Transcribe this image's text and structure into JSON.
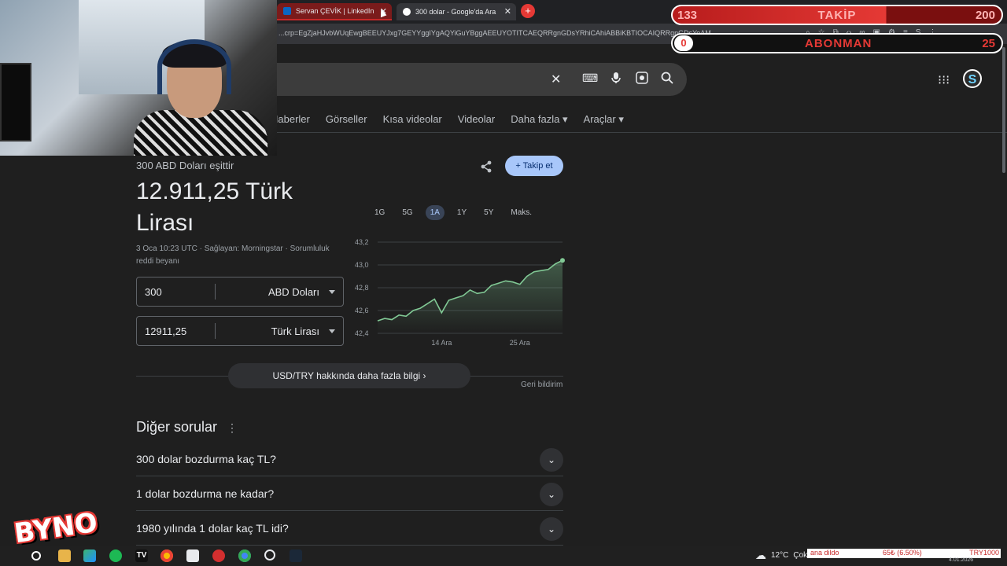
{
  "browser": {
    "tabs": [
      {
        "label": "Servan ÇEVİK | LinkedIn"
      },
      {
        "label": "300 dolar - Google'da Ara"
      }
    ],
    "new_tab": "+",
    "url": "...crp=EgZjaHJvbWUqEwgBEEUYJxg7GEYYggIYgAQYiGuYBggAEEUYOTITCAEQRRgnGDsYRhiCAhiABBiKBTIOCAIQRRgnGDsYoAM..."
  },
  "search": {
    "clear_icon": "✕",
    "keyboard_icon": "⌨",
    "mic_icon": "🎤",
    "lens_icon": "◉",
    "search_icon": "⌕"
  },
  "nav": {
    "tabs": [
      "Haberler",
      "Görseller",
      "Kısa videolar",
      "Videolar",
      "Daha fazla ▾",
      "Araçlar ▾"
    ]
  },
  "converter": {
    "equal_text": "300 ABD Doları eşittir",
    "result": "12.911,25 Türk Lirası",
    "source": "3 Oca 10:23 UTC · Sağlayan: Morningstar · Sorumluluk reddi beyanı",
    "follow_label": "+ Takip et",
    "from": {
      "value": "300",
      "currency": "ABD Doları"
    },
    "to": {
      "value": "12911,25",
      "currency": "Türk Lirası"
    },
    "ranges": [
      "1G",
      "5G",
      "1A",
      "1Y",
      "5Y",
      "Maks."
    ],
    "active_range": "1A",
    "more_button": "USD/TRY hakkında daha fazla bilgi  ›",
    "feedback": "Geri bildirim"
  },
  "chart_data": {
    "type": "area",
    "x_tick_labels": [
      "14 Ara",
      "25 Ara"
    ],
    "y_ticks": [
      42.4,
      42.6,
      42.8,
      43.0,
      43.2
    ],
    "y_tick_labels": [
      "42,4",
      "42,6",
      "42,8",
      "43,0",
      "43,2"
    ],
    "ylim": [
      42.4,
      43.2
    ],
    "values": [
      42.51,
      42.53,
      42.52,
      42.56,
      42.55,
      42.6,
      42.62,
      42.66,
      42.7,
      42.58,
      42.69,
      42.71,
      42.73,
      42.78,
      42.75,
      42.76,
      42.82,
      42.84,
      42.86,
      42.85,
      42.83,
      42.9,
      42.94,
      42.95,
      42.96,
      43.01,
      43.04
    ],
    "x_tick_index": [
      9,
      20
    ],
    "color": "#81c995",
    "grid": true
  },
  "other": {
    "title": "Diğer sorular",
    "menu": "⋮",
    "questions": [
      "300 dolar bozdurma kaç TL?",
      "1 dolar bozdurma ne kadar?",
      "1980 yılında 1 dolar kaç TL idi?"
    ]
  },
  "overlay": {
    "takip": {
      "count": "133",
      "label": "TAKİP",
      "goal": "200"
    },
    "abone": {
      "count": "0",
      "label": "ABONMAN",
      "goal": "25"
    },
    "logo": "BYNO"
  },
  "taskbar": {
    "temperature": "12°C",
    "weather": "Çok",
    "ticker_left": "ana dildo",
    "ticker_mid": "65₺ (6.50%)",
    "ticker_right": "TRY1000",
    "date": "4.01.2026"
  }
}
